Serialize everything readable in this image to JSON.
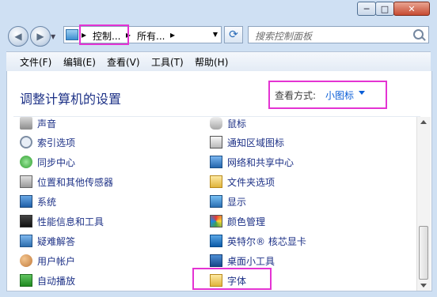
{
  "window": {
    "min_label": "─",
    "max_label": "□",
    "close_label": "✕"
  },
  "nav": {
    "breadcrumb": [
      "控制...",
      "所有..."
    ],
    "search_placeholder": "搜索控制面板"
  },
  "menu": [
    "文件(F)",
    "编辑(E)",
    "查看(V)",
    "工具(T)",
    "帮助(H)"
  ],
  "content": {
    "title": "调整计算机的设置",
    "view_label": "查看方式:",
    "view_value": "小图标"
  },
  "items_left": [
    {
      "label": "声音",
      "icon": "speaker-icon"
    },
    {
      "label": "索引选项",
      "icon": "indexing-icon"
    },
    {
      "label": "同步中心",
      "icon": "sync-icon"
    },
    {
      "label": "位置和其他传感器",
      "icon": "sensor-icon"
    },
    {
      "label": "系统",
      "icon": "system-icon"
    },
    {
      "label": "性能信息和工具",
      "icon": "performance-icon"
    },
    {
      "label": "疑难解答",
      "icon": "troubleshoot-icon"
    },
    {
      "label": "用户帐户",
      "icon": "users-icon"
    },
    {
      "label": "自动播放",
      "icon": "autoplay-icon"
    }
  ],
  "items_right": [
    {
      "label": "鼠标",
      "icon": "mouse-icon"
    },
    {
      "label": "通知区域图标",
      "icon": "notification-icon"
    },
    {
      "label": "网络和共享中心",
      "icon": "network-icon"
    },
    {
      "label": "文件夹选项",
      "icon": "folder-options-icon"
    },
    {
      "label": "显示",
      "icon": "display-icon"
    },
    {
      "label": "颜色管理",
      "icon": "color-icon"
    },
    {
      "label": "英特尔® 核芯显卡",
      "icon": "intel-graphics-icon"
    },
    {
      "label": "桌面小工具",
      "icon": "gadgets-icon"
    },
    {
      "label": "字体",
      "icon": "fonts-icon"
    }
  ]
}
